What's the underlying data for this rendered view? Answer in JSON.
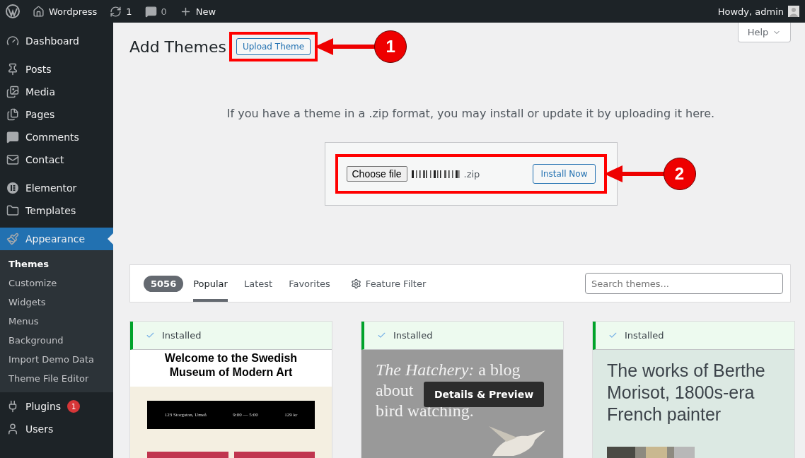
{
  "admin_bar": {
    "site": "Wordpress",
    "updates": "1",
    "comments": "0",
    "new": "New",
    "greeting": "Howdy, admin"
  },
  "sidebar": {
    "groups": [
      {
        "items": [
          {
            "label": "Dashboard",
            "selected": false
          }
        ]
      },
      {
        "items": [
          {
            "label": "Posts",
            "selected": false
          },
          {
            "label": "Media",
            "selected": false
          },
          {
            "label": "Pages",
            "selected": false
          },
          {
            "label": "Comments",
            "selected": false
          },
          {
            "label": "Contact",
            "selected": false
          }
        ]
      },
      {
        "items": [
          {
            "label": "Elementor",
            "selected": false
          },
          {
            "label": "Templates",
            "selected": false
          }
        ]
      },
      {
        "items": [
          {
            "label": "Appearance",
            "selected": true,
            "children": [
              {
                "label": "Themes",
                "selected": true
              },
              {
                "label": "Customize",
                "selected": false
              },
              {
                "label": "Widgets",
                "selected": false
              },
              {
                "label": "Menus",
                "selected": false
              },
              {
                "label": "Background",
                "selected": false
              },
              {
                "label": "Import Demo Data",
                "selected": false
              },
              {
                "label": "Theme File Editor",
                "selected": false
              }
            ]
          },
          {
            "label": "Plugins",
            "selected": false,
            "badge": "1"
          },
          {
            "label": "Users",
            "selected": false
          }
        ]
      }
    ]
  },
  "help": "Help",
  "header": {
    "title": "Add Themes",
    "upload_button": "Upload Theme",
    "annotation": "1"
  },
  "upload": {
    "message": "If you have a theme in a .zip format, you may install or update it by uploading it here.",
    "choose_button": "Choose file",
    "file_name": ".zip",
    "install_button": "Install Now",
    "annotation": "2"
  },
  "filter": {
    "count": "5056",
    "tabs": [
      {
        "label": "Popular",
        "selected": true
      },
      {
        "label": "Latest",
        "selected": false
      },
      {
        "label": "Favorites",
        "selected": false
      }
    ],
    "feature_filter": "Feature Filter",
    "search": {
      "placeholder": "Search themes..."
    }
  },
  "themes": [
    {
      "kind": "museum",
      "status": "Installed",
      "heading": "Welcome to the Swedish Museum of Modern Art",
      "details": [
        "123 Storgatan, Umeå",
        "9:00 — 5:00",
        "129 kr"
      ]
    },
    {
      "kind": "blog",
      "status": "Installed",
      "heading_lines": [
        "*The Hatchery:* a blog",
        "about",
        "bird watching."
      ],
      "overlay": "Details & Preview"
    },
    {
      "kind": "painter",
      "status": "Installed",
      "heading": "The works of Berthe Morisot, 1800s-era French painter"
    }
  ]
}
